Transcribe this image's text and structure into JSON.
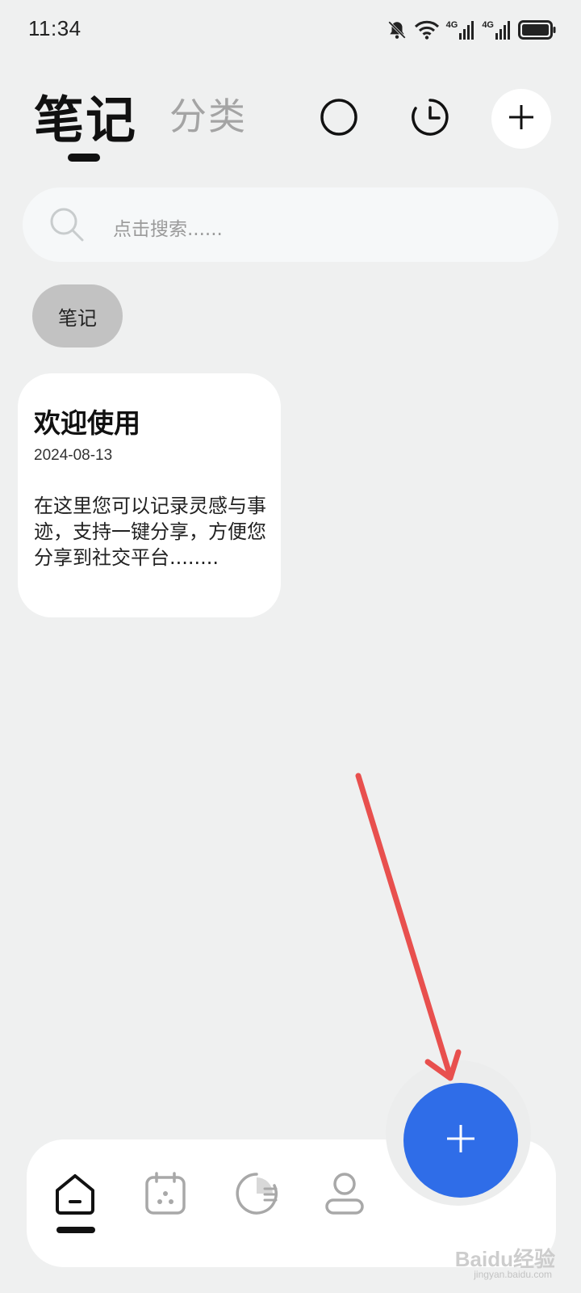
{
  "status_bar": {
    "time": "11:34",
    "icons": [
      "mute-bell-icon",
      "wifi-icon",
      "signal-4g-icon",
      "signal-4g-icon",
      "battery-icon"
    ],
    "network_label_1": "4G",
    "network_label_2": "4G"
  },
  "header": {
    "tabs": [
      {
        "label": "笔记",
        "active": true
      },
      {
        "label": "分类",
        "active": false
      }
    ],
    "actions": [
      "circle-icon",
      "clock-icon",
      "plus-icon"
    ]
  },
  "search": {
    "placeholder": "点击搜索......"
  },
  "filter_chip": {
    "label": "笔记"
  },
  "notes": [
    {
      "title": "欢迎使用",
      "date": "2024-08-13",
      "preview": "在这里您可以记录灵感与事迹，支持一键分享，方便您分享到社交平台........"
    }
  ],
  "fab": {
    "icon": "plus-icon",
    "color": "#2f6de8"
  },
  "bottom_nav": {
    "items": [
      "home-icon",
      "calendar-icon",
      "stats-icon",
      "profile-icon"
    ],
    "active": "home-icon"
  },
  "annotation": {
    "arrow_color": "#e8504e"
  },
  "watermark": {
    "text": "Baidu经验",
    "sub": "jingyan.baidu.com"
  }
}
